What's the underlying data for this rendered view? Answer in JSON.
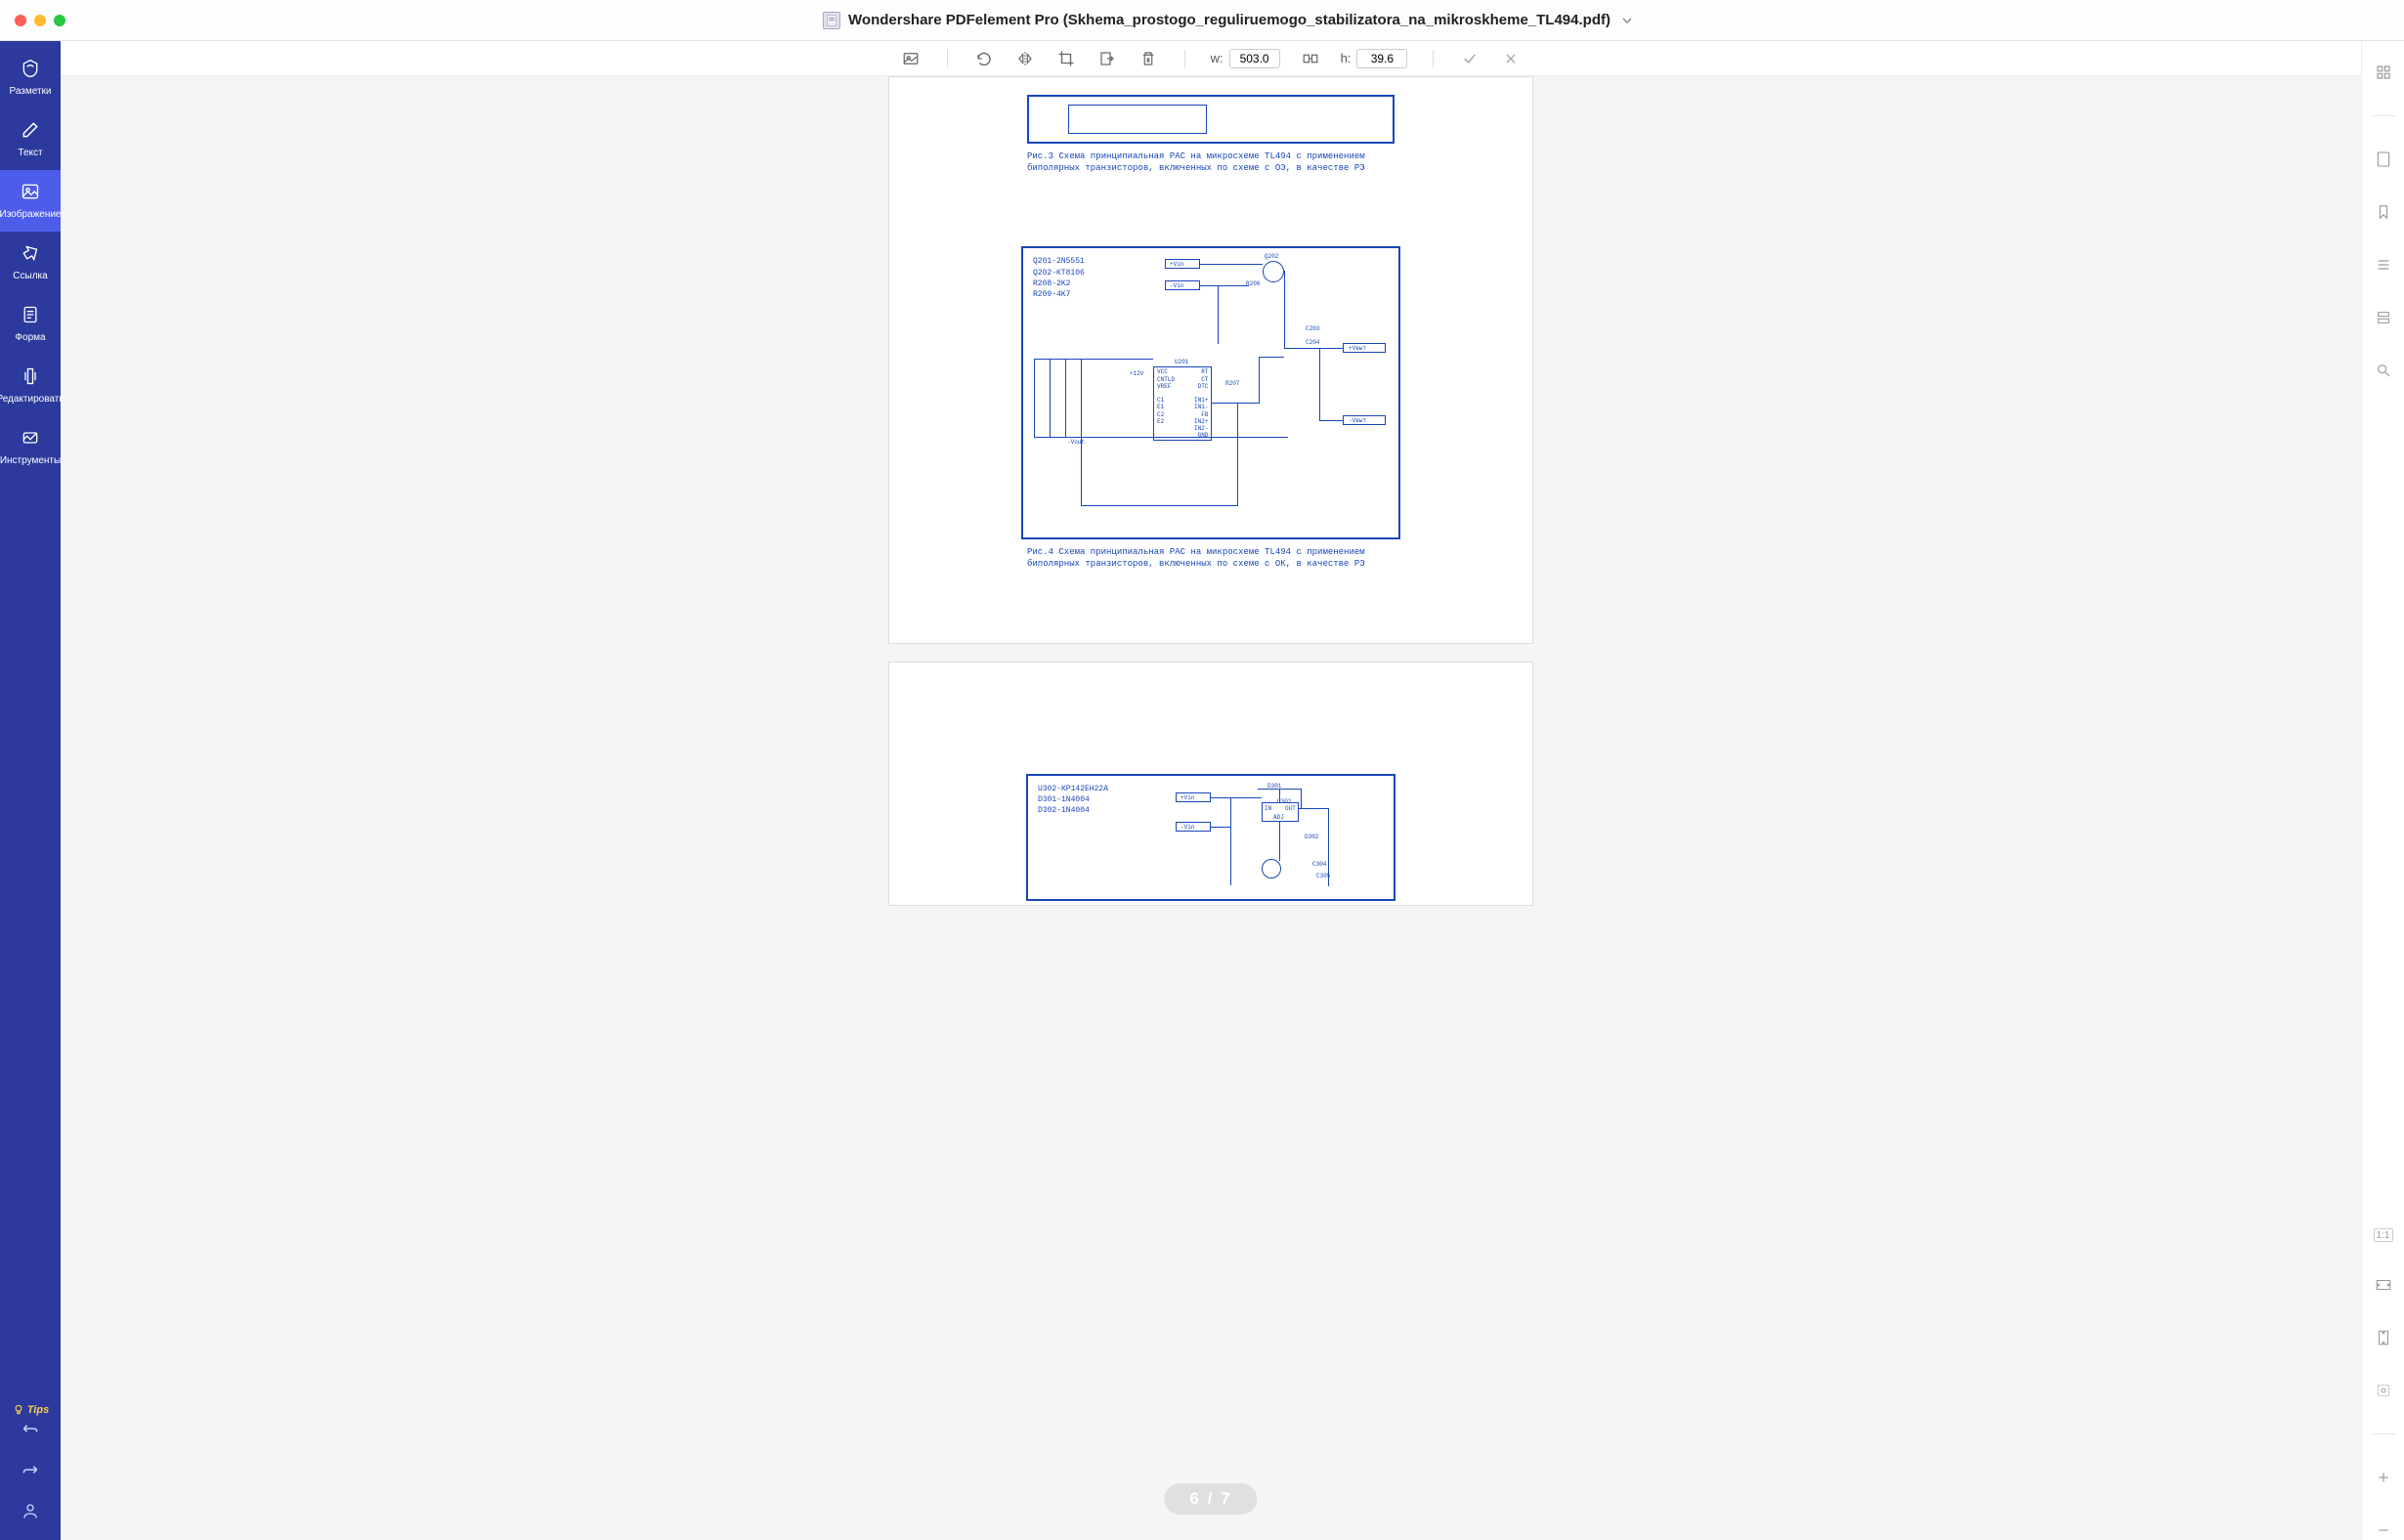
{
  "title": "Wondershare PDFelement Pro (Skhema_prostogo_reguliruemogo_stabilizatora_na_mikroskheme_TL494.pdf)",
  "left_rail": {
    "markup": "Разметки",
    "text": "Текст",
    "image": "Изображение",
    "link": "Ссылка",
    "form": "Форма",
    "edit": "Редактировать",
    "tools": "Инструменты",
    "tips": "Tips"
  },
  "toolbar": {
    "w_label": "w:",
    "w_value": "503.0",
    "h_label": "h:",
    "h_value": "39.6"
  },
  "captions": {
    "fig3": "Рис.3 Схема принципиальная РАС на микросхеме TL494 с применением биполярных транзисторов, включенных по схеме с ОЭ, в качестве РЭ",
    "fig4": "Рис.4 Схема принципиальная РАС на микросхеме TL494 с применением биполярных транзисторов, включенных по схеме с ОК, в качестве РЭ"
  },
  "schematic2": {
    "list": "Q201-2N5551\nQ202-КТ8106\nR208-2K2\nR209-4K7",
    "u": "U201",
    "q202": "Q202",
    "r200": "R200",
    "c203": "C203",
    "c204": "C204",
    "vin_p": "+Vin",
    "vin_n": "-Vin",
    "vout_p": "+Vвыт",
    "vout_n": "-Vвыт",
    "vout_label": "-Vout",
    "plus12": "+12V",
    "r207": "R207",
    "pins": "VCC\nCNTLD\nVREF\n\nC1\nE1\nC2\nE2",
    "pins_r": "RT\nCT\nDTC\n\nIN1+\nIN1-\nFB\nIN2+\nIN2-\nGND"
  },
  "schematic3": {
    "list": "U302-КР142ЕН22А\nD301-1N4004\nD302-1N4004",
    "d301": "D301",
    "u302": "U302",
    "d302": "D302",
    "in": "IN",
    "out": "OUT",
    "adj": "ADJ",
    "c304": "C304",
    "c305": "C305",
    "vin_p": "+Vin",
    "vin_n": "-Vin"
  },
  "page_indicator": {
    "current": "6",
    "sep": "/",
    "total": "7"
  }
}
